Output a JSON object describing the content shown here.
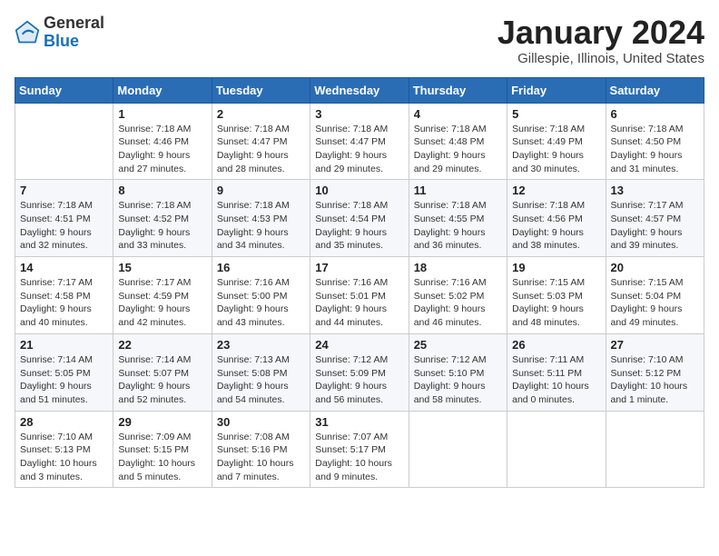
{
  "logo": {
    "general": "General",
    "blue": "Blue"
  },
  "header": {
    "month": "January 2024",
    "location": "Gillespie, Illinois, United States"
  },
  "weekdays": [
    "Sunday",
    "Monday",
    "Tuesday",
    "Wednesday",
    "Thursday",
    "Friday",
    "Saturday"
  ],
  "weeks": [
    [
      {
        "day": "",
        "info": ""
      },
      {
        "day": "1",
        "info": "Sunrise: 7:18 AM\nSunset: 4:46 PM\nDaylight: 9 hours\nand 27 minutes."
      },
      {
        "day": "2",
        "info": "Sunrise: 7:18 AM\nSunset: 4:47 PM\nDaylight: 9 hours\nand 28 minutes."
      },
      {
        "day": "3",
        "info": "Sunrise: 7:18 AM\nSunset: 4:47 PM\nDaylight: 9 hours\nand 29 minutes."
      },
      {
        "day": "4",
        "info": "Sunrise: 7:18 AM\nSunset: 4:48 PM\nDaylight: 9 hours\nand 29 minutes."
      },
      {
        "day": "5",
        "info": "Sunrise: 7:18 AM\nSunset: 4:49 PM\nDaylight: 9 hours\nand 30 minutes."
      },
      {
        "day": "6",
        "info": "Sunrise: 7:18 AM\nSunset: 4:50 PM\nDaylight: 9 hours\nand 31 minutes."
      }
    ],
    [
      {
        "day": "7",
        "info": "Sunrise: 7:18 AM\nSunset: 4:51 PM\nDaylight: 9 hours\nand 32 minutes."
      },
      {
        "day": "8",
        "info": "Sunrise: 7:18 AM\nSunset: 4:52 PM\nDaylight: 9 hours\nand 33 minutes."
      },
      {
        "day": "9",
        "info": "Sunrise: 7:18 AM\nSunset: 4:53 PM\nDaylight: 9 hours\nand 34 minutes."
      },
      {
        "day": "10",
        "info": "Sunrise: 7:18 AM\nSunset: 4:54 PM\nDaylight: 9 hours\nand 35 minutes."
      },
      {
        "day": "11",
        "info": "Sunrise: 7:18 AM\nSunset: 4:55 PM\nDaylight: 9 hours\nand 36 minutes."
      },
      {
        "day": "12",
        "info": "Sunrise: 7:18 AM\nSunset: 4:56 PM\nDaylight: 9 hours\nand 38 minutes."
      },
      {
        "day": "13",
        "info": "Sunrise: 7:17 AM\nSunset: 4:57 PM\nDaylight: 9 hours\nand 39 minutes."
      }
    ],
    [
      {
        "day": "14",
        "info": "Sunrise: 7:17 AM\nSunset: 4:58 PM\nDaylight: 9 hours\nand 40 minutes."
      },
      {
        "day": "15",
        "info": "Sunrise: 7:17 AM\nSunset: 4:59 PM\nDaylight: 9 hours\nand 42 minutes."
      },
      {
        "day": "16",
        "info": "Sunrise: 7:16 AM\nSunset: 5:00 PM\nDaylight: 9 hours\nand 43 minutes."
      },
      {
        "day": "17",
        "info": "Sunrise: 7:16 AM\nSunset: 5:01 PM\nDaylight: 9 hours\nand 44 minutes."
      },
      {
        "day": "18",
        "info": "Sunrise: 7:16 AM\nSunset: 5:02 PM\nDaylight: 9 hours\nand 46 minutes."
      },
      {
        "day": "19",
        "info": "Sunrise: 7:15 AM\nSunset: 5:03 PM\nDaylight: 9 hours\nand 48 minutes."
      },
      {
        "day": "20",
        "info": "Sunrise: 7:15 AM\nSunset: 5:04 PM\nDaylight: 9 hours\nand 49 minutes."
      }
    ],
    [
      {
        "day": "21",
        "info": "Sunrise: 7:14 AM\nSunset: 5:05 PM\nDaylight: 9 hours\nand 51 minutes."
      },
      {
        "day": "22",
        "info": "Sunrise: 7:14 AM\nSunset: 5:07 PM\nDaylight: 9 hours\nand 52 minutes."
      },
      {
        "day": "23",
        "info": "Sunrise: 7:13 AM\nSunset: 5:08 PM\nDaylight: 9 hours\nand 54 minutes."
      },
      {
        "day": "24",
        "info": "Sunrise: 7:12 AM\nSunset: 5:09 PM\nDaylight: 9 hours\nand 56 minutes."
      },
      {
        "day": "25",
        "info": "Sunrise: 7:12 AM\nSunset: 5:10 PM\nDaylight: 9 hours\nand 58 minutes."
      },
      {
        "day": "26",
        "info": "Sunrise: 7:11 AM\nSunset: 5:11 PM\nDaylight: 10 hours\nand 0 minutes."
      },
      {
        "day": "27",
        "info": "Sunrise: 7:10 AM\nSunset: 5:12 PM\nDaylight: 10 hours\nand 1 minute."
      }
    ],
    [
      {
        "day": "28",
        "info": "Sunrise: 7:10 AM\nSunset: 5:13 PM\nDaylight: 10 hours\nand 3 minutes."
      },
      {
        "day": "29",
        "info": "Sunrise: 7:09 AM\nSunset: 5:15 PM\nDaylight: 10 hours\nand 5 minutes."
      },
      {
        "day": "30",
        "info": "Sunrise: 7:08 AM\nSunset: 5:16 PM\nDaylight: 10 hours\nand 7 minutes."
      },
      {
        "day": "31",
        "info": "Sunrise: 7:07 AM\nSunset: 5:17 PM\nDaylight: 10 hours\nand 9 minutes."
      },
      {
        "day": "",
        "info": ""
      },
      {
        "day": "",
        "info": ""
      },
      {
        "day": "",
        "info": ""
      }
    ]
  ]
}
